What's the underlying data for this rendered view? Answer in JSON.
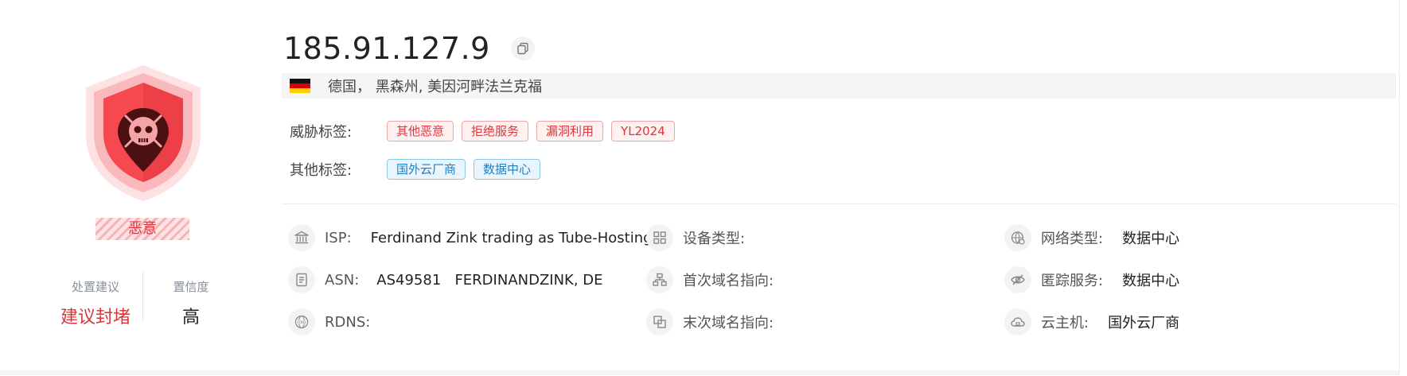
{
  "verdict": {
    "label": "恶意",
    "metrics": [
      {
        "label": "处置建议",
        "value": "建议封堵"
      },
      {
        "label": "置信度",
        "value": "高"
      }
    ]
  },
  "ip": "185.91.127.9",
  "location": {
    "country_flag": "DE",
    "text": "德国， 黑森州,  美因河畔法兰克福"
  },
  "tags": {
    "threat_label": "威胁标签:",
    "threat": [
      "其他恶意",
      "拒绝服务",
      "漏洞利用",
      "YL2024"
    ],
    "other_label": "其他标签:",
    "other": [
      "国外云厂商",
      "数据中心"
    ]
  },
  "info": {
    "isp": {
      "icon": "bank-icon",
      "label": "ISP:",
      "value": "Ferdinand Zink trading as Tube-Hosting"
    },
    "asn": {
      "icon": "document-icon",
      "label": "ASN:",
      "value": "AS49581   FERDINANDZINK, DE"
    },
    "rdns": {
      "icon": "rdns-globe-icon",
      "label": "RDNS:",
      "value": ""
    },
    "device_type": {
      "icon": "grid-icon",
      "label": "设备类型:",
      "value": ""
    },
    "first_domain": {
      "icon": "hierarchy-icon",
      "label": "首次域名指向:",
      "value": ""
    },
    "last_domain": {
      "icon": "overlap-squares-icon",
      "label": "末次域名指向:",
      "value": ""
    },
    "network_type": {
      "icon": "globe-network-icon",
      "label": "网络类型:",
      "value": "数据中心"
    },
    "anonymity": {
      "icon": "eye-slash-icon",
      "label": "匿踪服务:",
      "value": "数据中心"
    },
    "cloud_host": {
      "icon": "cloud-icon",
      "label": "云主机:",
      "value": "国外云厂商"
    }
  },
  "colors": {
    "malicious_red": "#e0353d",
    "threat_tag_red": "#d9363e",
    "other_tag_blue": "#1e7fc4"
  }
}
